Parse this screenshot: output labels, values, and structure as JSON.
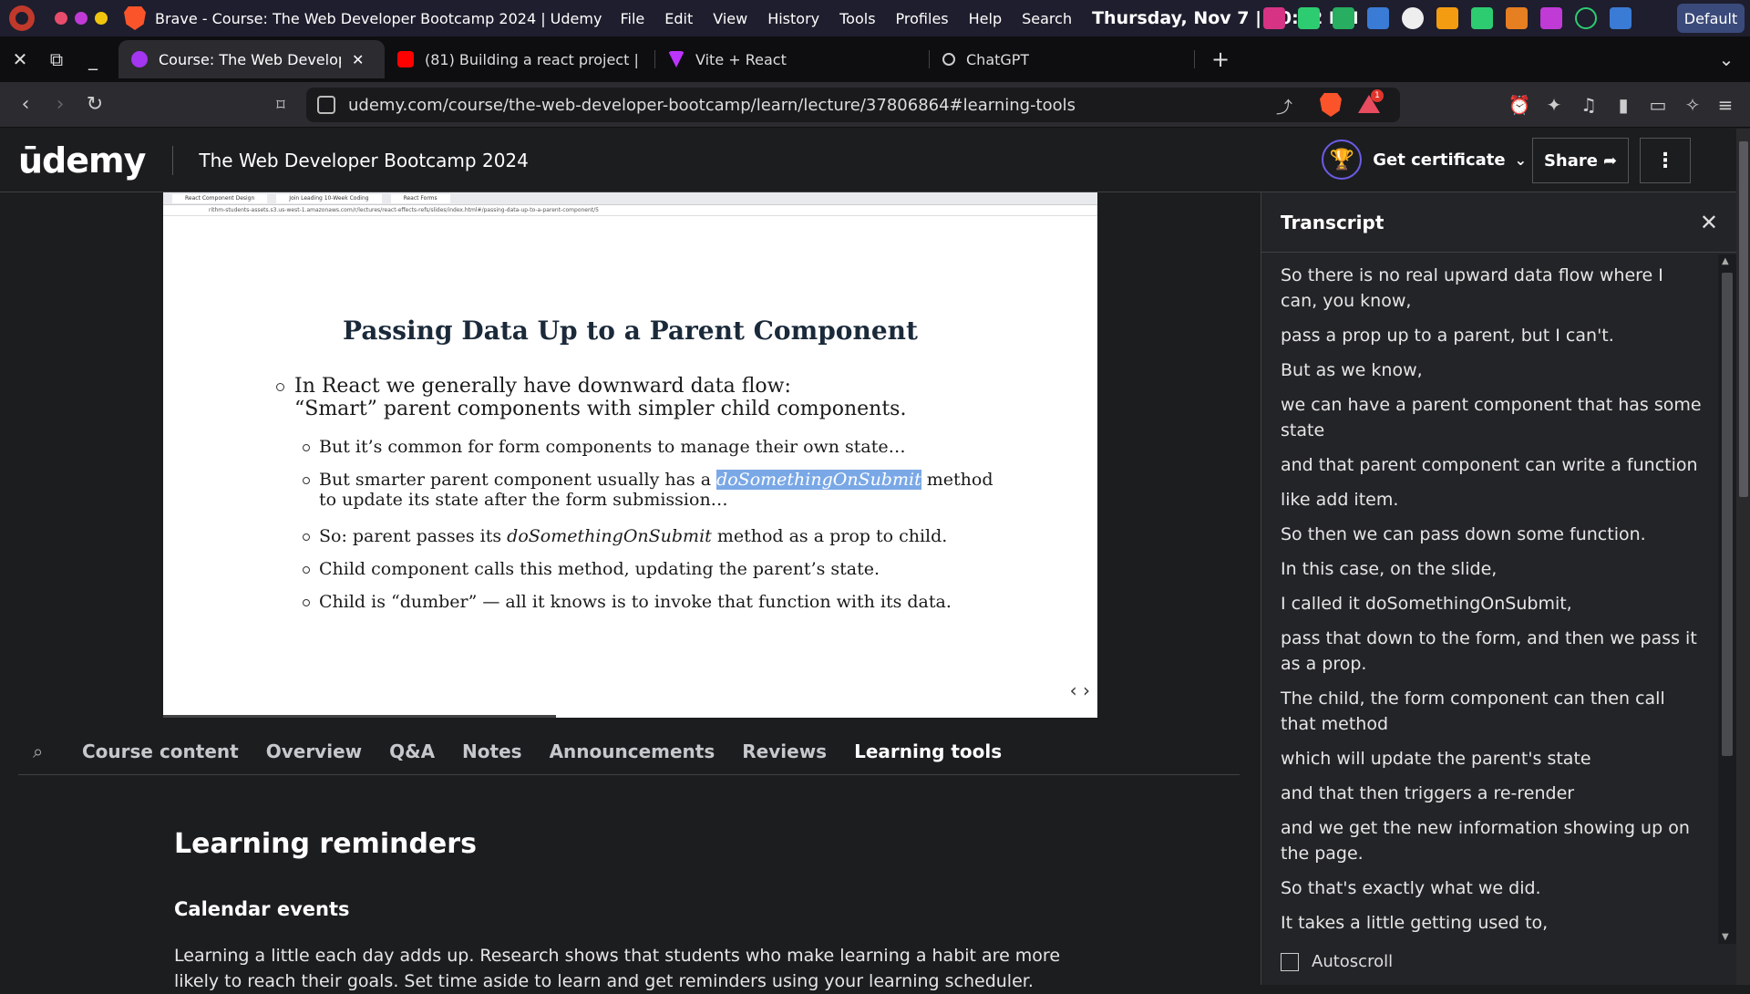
{
  "system": {
    "window_title": "Brave - Course: The Web Developer Bootcamp 2024 | Udemy",
    "menu": [
      "File",
      "Edit",
      "View",
      "History",
      "Tools",
      "Profiles",
      "Help",
      "Search"
    ],
    "clock": "Thursday, Nov 7 | 10:32 PM",
    "profile_button": "Default"
  },
  "tabs": [
    {
      "label": "Course: The Web Developer Bootcamp 2024",
      "favicon_color": "#a435f0",
      "active": true
    },
    {
      "label": "(81) Building a react project | bg",
      "favicon_color": "#ff0000",
      "active": false
    },
    {
      "label": "Vite + React",
      "favicon_color": "#bd34fe",
      "active": false
    },
    {
      "label": "ChatGPT",
      "favicon_color": "#cccccc",
      "active": false
    }
  ],
  "address": {
    "url": "udemy.com/course/the-web-developer-bootcamp/learn/lecture/37806864#learning-tools",
    "shield_badge": "8",
    "rewards_badge": "1"
  },
  "header": {
    "logo": "ūdemy",
    "course_title": "The Web Developer Bootcamp 2024",
    "certificate_label": "Get certificate",
    "share_label": "Share"
  },
  "video": {
    "mini_tabs": [
      "React Component Design",
      "Join Leading 10-Week Coding",
      "React Forms"
    ],
    "mini_url": "rithm-students-assets.s3.us-west-1.amazonaws.com/r/lectures/react-effects-refs/slides/index.html#/passing-data-up-to-a-parent-component/5",
    "slide_title": "Passing Data Up to a Parent Component",
    "bullet1_line1": "In React we generally have downward data flow:",
    "bullet1_line2": "“Smart” parent components with simpler child components.",
    "sub1": "But it’s common for form components to manage their own state…",
    "sub2_pre": "But smarter parent component usually has a ",
    "sub2_hl": "doSomethingOnSubmit",
    "sub2_post": " method",
    "sub2_line2": "to update its state after the form submission…",
    "sub3_pre": "So: parent passes its ",
    "sub3_it": "doSomethingOnSubmit",
    "sub3_post": " method as a prop to child.",
    "sub4": "Child component calls this method, updating the parent’s state.",
    "sub5": "Child is “dumber” — all it knows is to invoke that function with its data.",
    "progress": 0.42
  },
  "course_tabs": [
    "Course content",
    "Overview",
    "Q&A",
    "Notes",
    "Announcements",
    "Reviews",
    "Learning tools"
  ],
  "learning": {
    "title": "Learning reminders",
    "calendar_title": "Calendar events",
    "text": "Learning a little each day adds up. Research shows that students who make learning a habit are more likely to reach their goals. Set time aside to learn and get reminders using your learning scheduler."
  },
  "transcript": {
    "title": "Transcript",
    "lines": [
      "So there is no real upward data flow where I can, you know,",
      "pass a prop up to a parent, but I can't.",
      "But as we know,",
      "we can have a parent component that has some state",
      "and that parent component can write a function",
      "like add item.",
      "So then we can pass down some function.",
      "In this case, on the slide,",
      "I called it doSomethingOnSubmit,",
      "pass that down to the form, and then we pass it as a prop.",
      "The child, the form component can then call that method",
      "which will update the parent's state",
      "and that then triggers a re-render",
      "and we get the new information showing up on the page.",
      "So that's exactly what we did.",
      "It takes a little getting used to,"
    ],
    "autoscroll_label": "Autoscroll"
  }
}
